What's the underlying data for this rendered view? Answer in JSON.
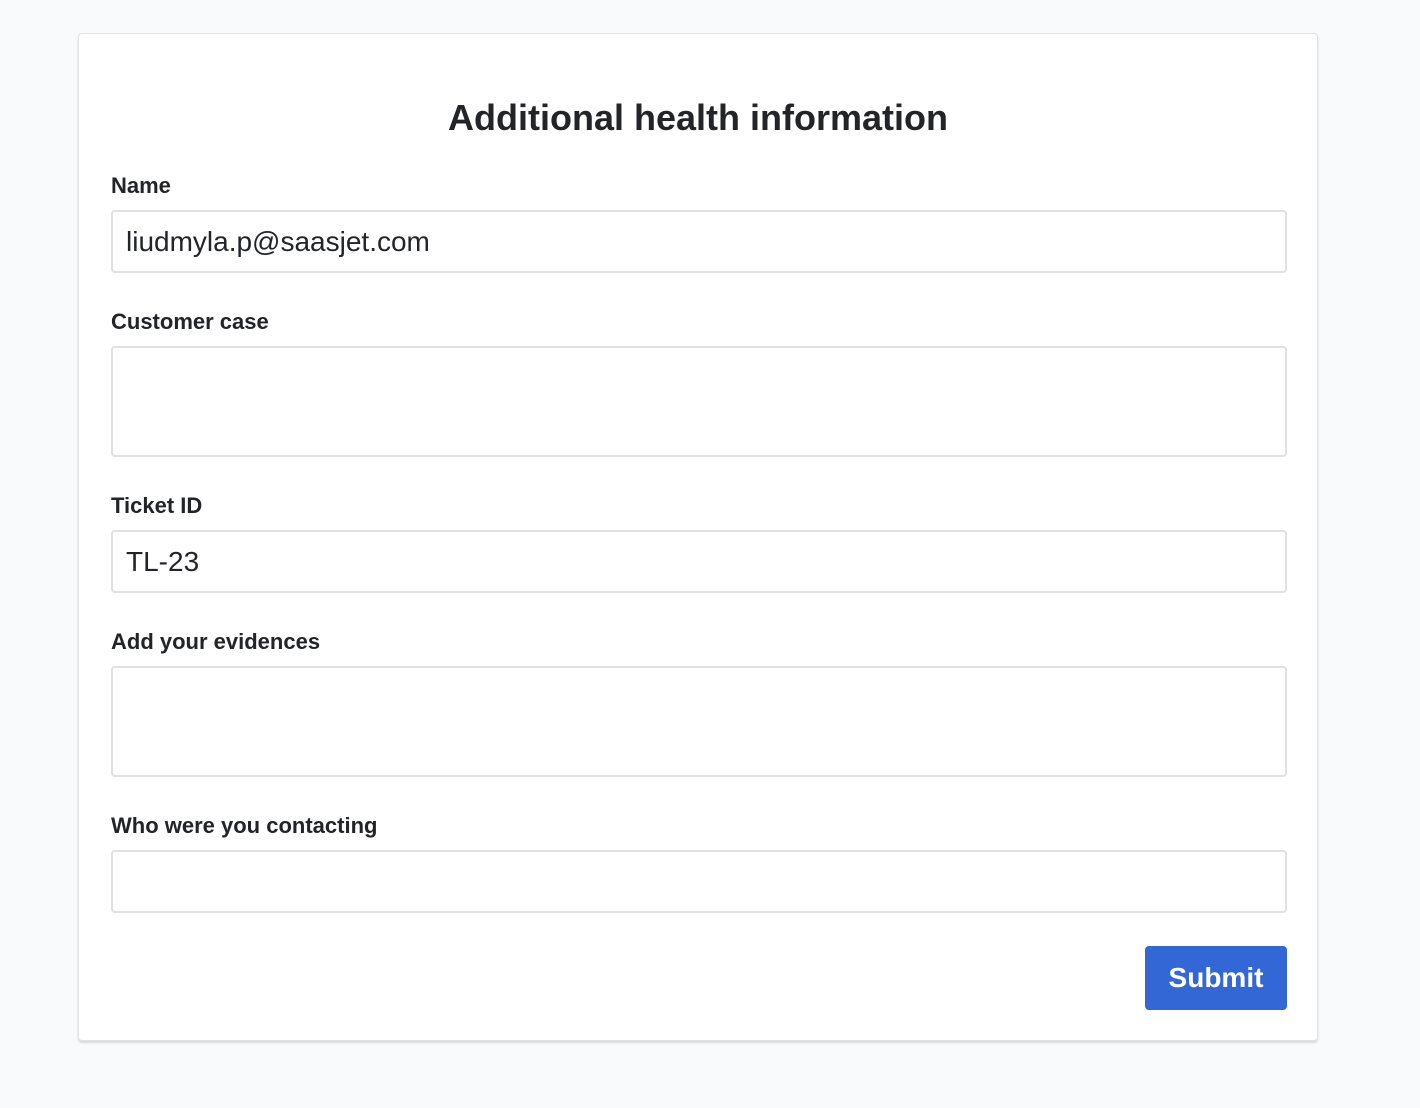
{
  "form": {
    "title": "Additional health information",
    "fields": [
      {
        "label": "Name",
        "value": "liudmyla.p@saasjet.com",
        "placeholder": ""
      },
      {
        "label": "Customer case",
        "value": "",
        "placeholder": ""
      },
      {
        "label": "Ticket ID",
        "value": "TL-23",
        "placeholder": ""
      },
      {
        "label": "Add your evidences",
        "value": "",
        "placeholder": ""
      },
      {
        "label": "Who were you contacting",
        "value": "",
        "placeholder": ""
      }
    ],
    "submit_label": "Submit"
  },
  "colors": {
    "background": "#f9fafc",
    "card": "#ffffff",
    "text": "#222428",
    "field_border": "#dfe1e5",
    "primary": "#3367d6"
  }
}
